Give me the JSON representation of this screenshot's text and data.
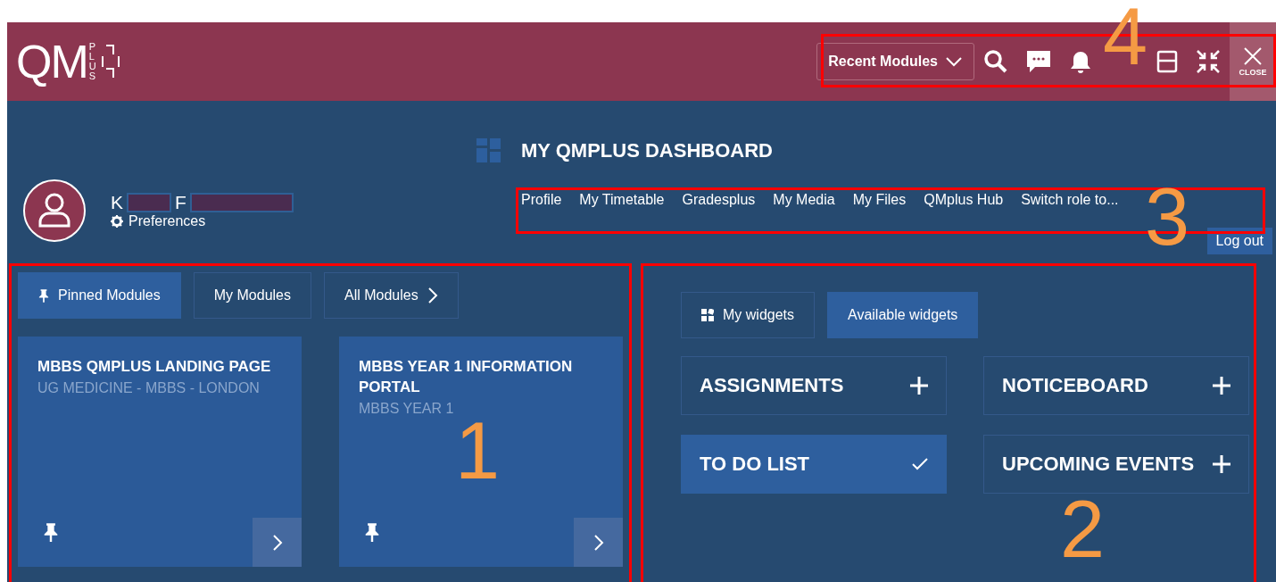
{
  "header": {
    "logo": "QM",
    "logo_sub": "PLUS",
    "recent_modules": "Recent Modules",
    "close_label": "CLOSE"
  },
  "user": {
    "name_initials": [
      "K",
      "F"
    ],
    "preferences": "Preferences"
  },
  "dashboard": {
    "title": "MY QMPLUS DASHBOARD",
    "nav": [
      "Profile",
      "My Timetable",
      "Gradesplus",
      "My Media",
      "My Files",
      "QMplus Hub",
      "Switch role to..."
    ],
    "logout": "Log out"
  },
  "module_tabs": [
    {
      "label": "Pinned Modules",
      "selected": true
    },
    {
      "label": "My Modules",
      "selected": false
    },
    {
      "label": "All Modules",
      "selected": false
    }
  ],
  "modules": [
    {
      "title": "MBBS QMPLUS LANDING PAGE",
      "subtitle": "UG MEDICINE - MBBS - LONDON"
    },
    {
      "title": "MBBS YEAR 1 INFORMATION PORTAL",
      "subtitle": "MBBS YEAR 1"
    }
  ],
  "widget_tabs": [
    {
      "label": "My widgets",
      "selected": false
    },
    {
      "label": "Available widgets",
      "selected": true
    }
  ],
  "widgets": [
    {
      "label": "ASSIGNMENTS",
      "selected": false
    },
    {
      "label": "NOTICEBOARD",
      "selected": false
    },
    {
      "label": "TO DO LIST",
      "selected": true
    },
    {
      "label": "UPCOMING EVENTS",
      "selected": false
    }
  ],
  "annotations": [
    {
      "number": "1"
    },
    {
      "number": "2"
    },
    {
      "number": "3"
    },
    {
      "number": "4"
    }
  ]
}
